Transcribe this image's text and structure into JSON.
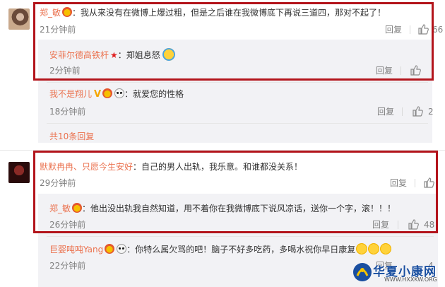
{
  "comments": [
    {
      "user": "郑_敏",
      "text": "：我从来没有在微博上爆过粗，但是之后谁在我微博底下再说三道四，那对不起了！",
      "time": "21分钟前",
      "reply_label": "回复",
      "like_count": "66",
      "replies": [
        {
          "user": "安菲尔德高铁杆",
          "text": "：郑姐息怒",
          "time": "2分钟前",
          "reply_label": "回复",
          "like_count": ""
        },
        {
          "user": "我不是翔儿",
          "text": "：就爱您的性格",
          "time": "18分钟前",
          "reply_label": "回复",
          "like_count": "2"
        }
      ],
      "more_replies": "共10条回复"
    },
    {
      "user": "默默冉冉、只愿今生安好",
      "text": "：自己的男人出轨，我乐意。和谁都没关系！",
      "time": "29分钟前",
      "reply_label": "回复",
      "like_count": "",
      "replies": [
        {
          "user": "郑_敏",
          "text": "：他出没出轨我自然知道，用不着你在我微博底下说风凉话，送你一个字，滚！！！",
          "time": "26分钟前",
          "reply_label": "回复",
          "like_count": "48"
        },
        {
          "user": "巨婴吨吨Yang",
          "text": "：你特么属欠骂的吧！脑子不好多吃药，多喝水祝你早日康复",
          "time": "22分钟前",
          "reply_label": "回复",
          "like_count": "4"
        }
      ]
    }
  ],
  "watermark": {
    "title": "华夏小康网",
    "url": "WWW.HXXKW.ORG"
  },
  "colors": {
    "username": "#eb7350",
    "highlight_border": "#b3141b",
    "meta": "#808080"
  }
}
